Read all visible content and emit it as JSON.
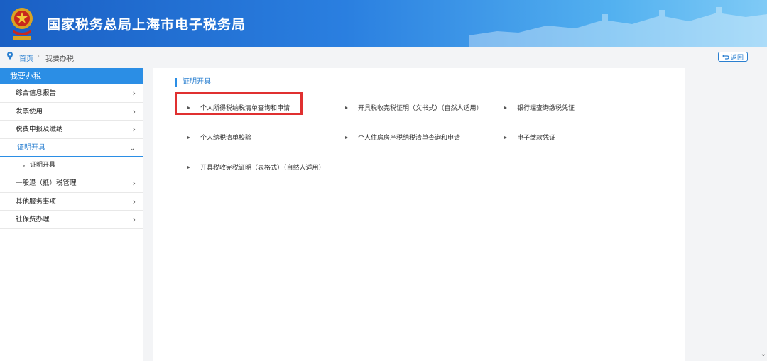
{
  "header": {
    "title": "国家税务总局上海市电子税务局",
    "emblem_icon": "tax-emblem-icon"
  },
  "breadcrumb": {
    "home": "首页",
    "separator": "›",
    "current": "我要办税"
  },
  "back_button": {
    "label": "返回"
  },
  "sidebar": {
    "heading": "我要办税",
    "items": [
      {
        "label": "综合信息报告"
      },
      {
        "label": "发票使用"
      },
      {
        "label": "税费申报及缴纳"
      },
      {
        "label": "证明开具"
      },
      {
        "label": "一般退（抵）税管理"
      },
      {
        "label": "其他服务事项"
      },
      {
        "label": "社保费办理"
      }
    ],
    "sub_item": {
      "label": "证明开具"
    }
  },
  "main": {
    "section_title": "证明开具",
    "links": [
      {
        "label": "个人所得税纳税清单查询和申请"
      },
      {
        "label": "开具税收完税证明（文书式）（自然人适用）"
      },
      {
        "label": "银行端查询缴税凭证"
      },
      {
        "label": "个人纳税清单校验"
      },
      {
        "label": "个人住房房产税纳税清单查询和申请"
      },
      {
        "label": "电子缴款凭证"
      },
      {
        "label": "开具税收完税证明（表格式）（自然人适用）"
      }
    ]
  },
  "colors": {
    "header_blue": "#1a5fc4",
    "accent": "#2b8ee5",
    "highlight_red": "#e03030"
  }
}
